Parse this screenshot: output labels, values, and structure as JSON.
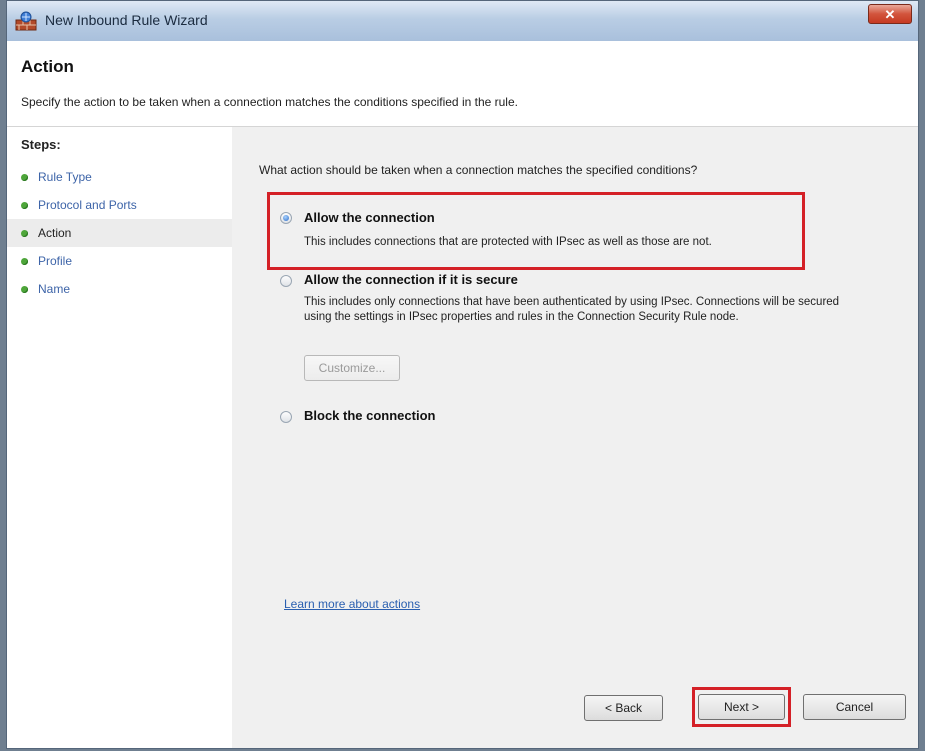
{
  "window": {
    "title": "New Inbound Rule Wizard",
    "close_glyph": "✕"
  },
  "header": {
    "title": "Action",
    "description": "Specify the action to be taken when a connection matches the conditions specified in the rule."
  },
  "steps": {
    "title": "Steps:",
    "items": [
      {
        "label": "Rule Type"
      },
      {
        "label": "Protocol and Ports"
      },
      {
        "label": "Action"
      },
      {
        "label": "Profile"
      },
      {
        "label": "Name"
      }
    ]
  },
  "main": {
    "question": "What action should be taken when a connection matches the specified conditions?",
    "options": [
      {
        "label": "Allow the connection",
        "description": "This includes connections that are protected with IPsec as well as those are not.",
        "selected": true
      },
      {
        "label": "Allow the connection if it is secure",
        "description": "This includes only connections that have been authenticated by using IPsec.  Connections will be secured using the settings in IPsec properties and rules in the Connection Security Rule node.",
        "selected": false
      },
      {
        "label": "Block the connection",
        "description": "",
        "selected": false
      }
    ],
    "customize_label": "Customize...",
    "learn_more": "Learn more about actions"
  },
  "buttons": {
    "back": "< Back",
    "next": "Next >",
    "cancel": "Cancel"
  },
  "colors": {
    "highlight": "#d42027",
    "link": "#2a5fb0",
    "step_bullet": "#4ea63a"
  }
}
